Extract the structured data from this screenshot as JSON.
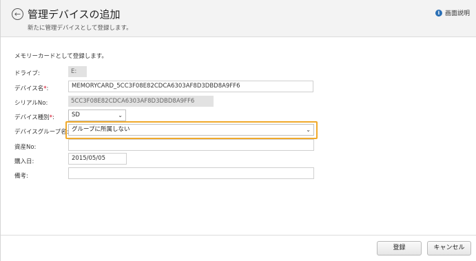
{
  "header": {
    "title": "管理デバイスの追加",
    "subtitle": "新たに管理デバイスとして登録します。",
    "help_label": "画面説明",
    "help_icon": "info-icon",
    "back_icon": "back-arrow-icon"
  },
  "form": {
    "intro": "メモリーカードとして登録します。",
    "drive": {
      "label": "ドライブ:",
      "value": "E:"
    },
    "device_name": {
      "label": "デバイス名",
      "required_mark": "*",
      "suffix": ":",
      "value": "MEMORYCARD_5CC3F08E82CDCA6303AF8D3DBD8A9FF6"
    },
    "serial_no": {
      "label": "シリアルNo:",
      "value": "5CC3F08E82CDCA6303AF8D3DBD8A9FF6"
    },
    "device_type": {
      "label": "デバイス種別",
      "required_mark": "*",
      "suffix": ":",
      "value": "SD"
    },
    "device_group": {
      "label": "デバイスグループ名:",
      "value": "グループに所属しない"
    },
    "asset_no": {
      "label": "資産No:",
      "value": ""
    },
    "purchase_date": {
      "label": "購入日:",
      "value": "2015/05/05"
    },
    "remarks": {
      "label": "備考:",
      "value": ""
    }
  },
  "footer": {
    "register_label": "登録",
    "cancel_label": "キャンセル"
  },
  "colors": {
    "highlight": "#f0a92a",
    "required": "#d0021b",
    "help_icon": "#2a6fb5"
  }
}
